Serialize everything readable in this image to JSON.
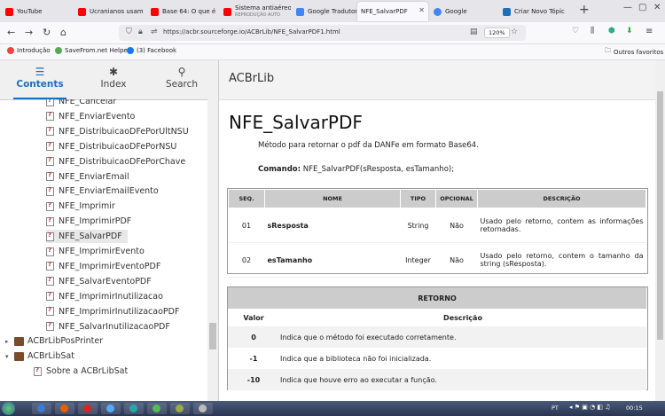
{
  "tabs": [
    {
      "label": "YouTube",
      "color": "#ff0000"
    },
    {
      "label": "Ucranianos usam",
      "color": "#ff0000"
    },
    {
      "label": "Base 64: O que é",
      "color": "#ff0000"
    },
    {
      "label": "Sistema antiaéreo",
      "sub": "REPRODUÇÃO AUTO",
      "color": "#ff0000"
    },
    {
      "label": "Google Tradutor",
      "color": "#4285f4"
    },
    {
      "label": "NFE_SalvarPDF",
      "color": "#ffffff"
    },
    {
      "label": "Google",
      "color": "#4285f4"
    },
    {
      "label": "Criar Novo Tópic",
      "color": "#1e6fbb"
    }
  ],
  "url": "https://acbr.sourceforge.io/ACBrLib/NFE_SalvarPDF1.html",
  "zoom": "120%",
  "bookmarks": {
    "items": [
      {
        "label": "Introdução",
        "color": "#e44"
      },
      {
        "label": "SaveFrom.net Helper",
        "color": "#5a5"
      },
      {
        "label": "(3) Facebook",
        "color": "#1877f2"
      }
    ],
    "other": "Outros favoritos"
  },
  "sidebar": {
    "tabs": [
      {
        "label": "Contents",
        "icon": "list-icon"
      },
      {
        "label": "Index",
        "icon": "asterisk-icon"
      },
      {
        "label": "Search",
        "icon": "search-icon"
      }
    ],
    "tree": [
      {
        "label": "NFE_Cancelar",
        "level": 2
      },
      {
        "label": "NFE_EnviarEvento",
        "level": 2
      },
      {
        "label": "NFE_DistribuicaoDFePorUltNSU",
        "level": 2
      },
      {
        "label": "NFE_DistribuicaoDFePorNSU",
        "level": 2
      },
      {
        "label": "NFE_DistribuicaoDFePorChave",
        "level": 2
      },
      {
        "label": "NFE_EnviarEmail",
        "level": 2
      },
      {
        "label": "NFE_EnviarEmailEvento",
        "level": 2
      },
      {
        "label": "NFE_Imprimir",
        "level": 2
      },
      {
        "label": "NFE_ImprimirPDF",
        "level": 2
      },
      {
        "label": "NFE_SalvarPDF",
        "level": 2,
        "selected": true
      },
      {
        "label": "NFE_ImprimirEvento",
        "level": 2
      },
      {
        "label": "NFE_ImprimirEventoPDF",
        "level": 2
      },
      {
        "label": "NFE_SalvarEventoPDF",
        "level": 2
      },
      {
        "label": "NFE_ImprimirInutilizacao",
        "level": 2
      },
      {
        "label": "NFE_ImprimirInutilizacaoPDF",
        "level": 2
      },
      {
        "label": "NFE_SalvarInutilizacaoPDF",
        "level": 2
      },
      {
        "label": "ACBrLibPosPrinter",
        "level": 0,
        "book": true,
        "arrow": "▸"
      },
      {
        "label": "ACBrLibSat",
        "level": 0,
        "book": true,
        "arrow": "▾"
      },
      {
        "label": "Sobre a ACBrLibSat",
        "level": 1
      }
    ]
  },
  "content": {
    "header": "ACBrLib",
    "title": "NFE_SalvarPDF",
    "description": "Método para retornar o pdf da DANFe em formato Base64.",
    "command_label": "Comando:",
    "command": "NFE_SalvarPDF(sResposta, esTamanho);",
    "params": {
      "headers": [
        "SEQ.",
        "NOME",
        "TIPO",
        "OPCIONAL",
        "DESCRIÇÃO"
      ],
      "rows": [
        [
          "01",
          "sResposta",
          "String",
          "Não",
          "Usado pelo retorno, contem as informações retornadas."
        ],
        [
          "02",
          "esTamanho",
          "Integer",
          "Não",
          "Usado pelo retorno, contem o tamanho da string (sResposta)."
        ]
      ]
    },
    "retorno": {
      "caption": "RETORNO",
      "headers": [
        "Valor",
        "Descrição"
      ],
      "rows": [
        [
          "0",
          "Indica que o método foi executado corretamente."
        ],
        [
          "-1",
          "Indica que a biblioteca não foi inicializada."
        ],
        [
          "-10",
          "Indica que houve erro ao executar a função."
        ]
      ]
    }
  },
  "taskbar": {
    "lang": "PT",
    "time": "00:15"
  }
}
